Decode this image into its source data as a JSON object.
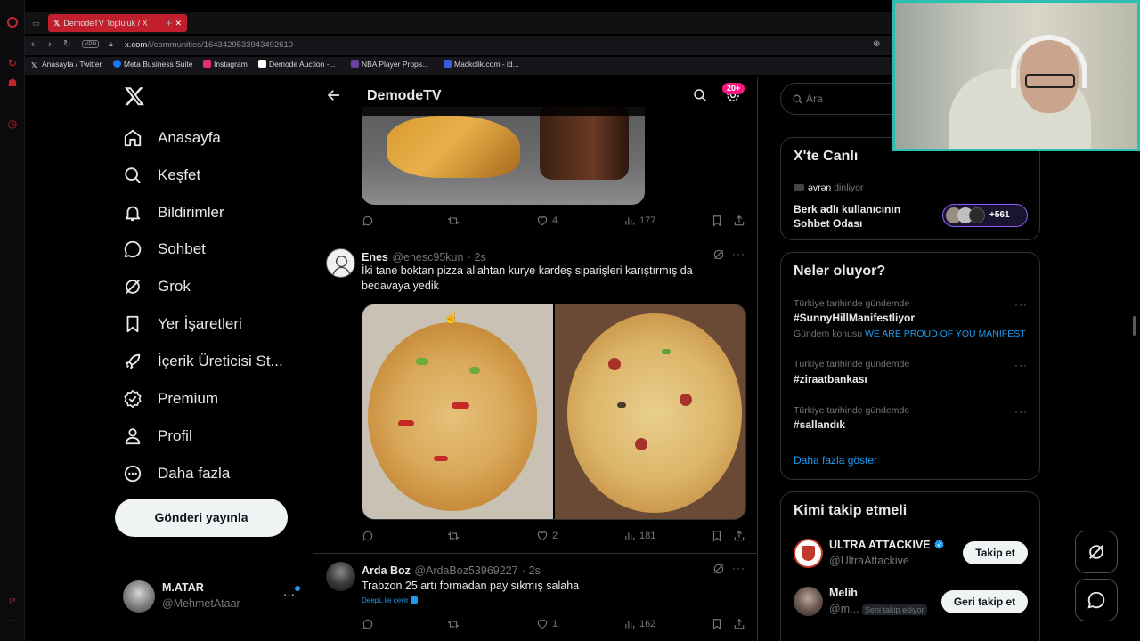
{
  "browser": {
    "tab_title": "DemodeTV Topluluk / X",
    "url_domain": "x.com",
    "url_path": "/i/communities/1643429533943492610",
    "vpn_label": "VPN",
    "bookmarks": [
      {
        "label": "Anasayfa / Twitter",
        "color": "#ffffff"
      },
      {
        "label": "Meta Business Suite",
        "color": "#1877f2"
      },
      {
        "label": "Instagram",
        "color": "#e1306c"
      },
      {
        "label": "Demode Auction -...",
        "color": "#ffffff"
      },
      {
        "label": "NBA Player Props...",
        "color": "#6b3fa0"
      },
      {
        "label": "Mackolik.com - id...",
        "color": "#3b5bdb"
      }
    ]
  },
  "nav": {
    "items": [
      {
        "label": "Anasayfa",
        "icon": "home-icon"
      },
      {
        "label": "Keşfet",
        "icon": "search-icon"
      },
      {
        "label": "Bildirimler",
        "icon": "bell-icon"
      },
      {
        "label": "Sohbet",
        "icon": "chat-icon"
      },
      {
        "label": "Grok",
        "icon": "grok-icon"
      },
      {
        "label": "Yer İşaretleri",
        "icon": "bookmark-icon"
      },
      {
        "label": "İçerik Üreticisi St...",
        "icon": "rocket-icon"
      },
      {
        "label": "Premium",
        "icon": "verified-icon"
      },
      {
        "label": "Profil",
        "icon": "person-icon"
      },
      {
        "label": "Daha fazla",
        "icon": "more-icon"
      }
    ],
    "post_button": "Gönderi yayınla",
    "account_name": "M.ATAR",
    "account_handle": "@MehmetAtaar"
  },
  "timeline": {
    "title": "DemodeTV",
    "badge": "20+",
    "tweets": [
      {
        "replies": "",
        "retweets": "",
        "likes": "4",
        "views": "177"
      },
      {
        "name": "Enes",
        "handle": "@enesc95kun",
        "time": "· 2s",
        "text": "İki tane boktan pizza allahtan kurye kardeş siparişleri karıştırmış da bedavaya yedik",
        "likes": "2",
        "views": "181"
      },
      {
        "name": "Arda Boz",
        "handle": "@ArdaBoz53969227",
        "time": "· 2s",
        "text": "Trabzon 25 artı formadan pay sıkmış salaha",
        "translate": "DeepL ile çevir",
        "likes": "1",
        "views": "162"
      }
    ]
  },
  "right": {
    "search_placeholder": "Ara",
    "live": {
      "title": "X'te Canlı",
      "host": "əvrən",
      "host_suffix": "dinliyor",
      "room_title": "Berk adlı kullanıcının Sohbet Odası",
      "listeners": "+561"
    },
    "trends": {
      "title": "Neler oluyor?",
      "items": [
        {
          "context": "Türkiye tarihinde gündemde",
          "tag": "#SunnyHillManifestliyor",
          "extra_label": "Gündem konusu",
          "extra_link": "WE ARE PROUD OF YOU MANİFEST"
        },
        {
          "context": "Türkiye tarihinde gündemde",
          "tag": "#ziraatbankası"
        },
        {
          "context": "Türkiye tarihinde gündemde",
          "tag": "#sallandık"
        }
      ],
      "show_more": "Daha fazla göster"
    },
    "who_to_follow": {
      "title": "Kimi takip etmeli",
      "accounts": [
        {
          "name": "ULTRA ATTACKIVE",
          "handle": "@UltraAttackive",
          "button": "Takip et"
        },
        {
          "name": "Melih",
          "handle": "@m...",
          "follows_you": "Seni takip ediyor",
          "button": "Geri takip et"
        }
      ]
    }
  },
  "colors": {
    "accent": "#1d9bf0",
    "badge": "#f91880",
    "opera_red": "#c21f2d",
    "webcam_border": "#2bbfb0"
  }
}
